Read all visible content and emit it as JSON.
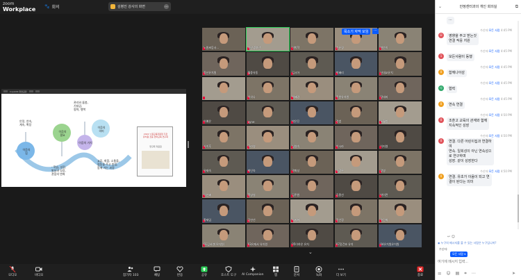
{
  "app": {
    "brand_small": "zoom",
    "brand": "Workplace",
    "meeting_label": "회의",
    "share_label": "김병진 강사의 화면"
  },
  "shared": {
    "doc_title": "CopilotR 화면공유",
    "slide_left_1": "안정, 연속,\n계속, 확장",
    "circle_1": "이음의\n힘",
    "circle_2": "이음의\n필요",
    "circle_3": "이음의 가치",
    "circle_4": "이음의\n의미",
    "caption_top": "관리와 돌봄,\n기대감,\n협력, 행복",
    "caption_mid": "- 학습, 성장,\n발달과 성장,\n관점의 변화",
    "caption_right": "교류, 화합, 소통을,\n협동을 주고 받음,\n함께 가는 과정",
    "thumb_title": "2022 노원교육지원청 기관\n유치원 초등 협력교육 연구회",
    "thumb_sub": "연구회 자료집"
  },
  "gallery": {
    "badge": "목소기 자막 모임",
    "menu": "⋯",
    "tiles": [
      {
        "name": "노원초등사..."
      },
      {
        "name": "이안생영안"
      },
      {
        "name": "이박학"
      },
      {
        "name": "순유경"
      },
      {
        "name": "변순이"
      },
      {
        "name": "중산유치원"
      },
      {
        "name": "월중유동"
      },
      {
        "name": "김시아"
      },
      {
        "name": "박혜리"
      },
      {
        "name": "신대교유치"
      },
      {
        "name": ""
      },
      {
        "name": "이삭나"
      },
      {
        "name": "백혜경"
      },
      {
        "name": "주원유치원"
      },
      {
        "name": "장대지"
      },
      {
        "name": "이예은"
      },
      {
        "name": "ayne"
      },
      {
        "name": "박은진"
      },
      {
        "name": "경범"
      },
      {
        "name": "노월방"
      },
      {
        "name": "사이후"
      },
      {
        "name": "구라영"
      },
      {
        "name": "심영숙"
      },
      {
        "name": "이시라"
      },
      {
        "name": "이지영"
      },
      {
        "name": "유재숙"
      },
      {
        "name": "최인숙"
      },
      {
        "name": "곽화성"
      },
      {
        "name": "사광우"
      },
      {
        "name": "광영"
      },
      {
        "name": "이선혜"
      },
      {
        "name": "홍영실"
      },
      {
        "name": "김주원"
      },
      {
        "name": "김종선"
      },
      {
        "name": "박이란"
      },
      {
        "name": "홍재임"
      },
      {
        "name": "김연선"
      },
      {
        "name": "차지화"
      },
      {
        "name": "정인정"
      },
      {
        "name": "우단화"
      },
      {
        "name": "01김서연(유치원)"
      },
      {
        "name": "03유재서 유치원"
      },
      {
        "name": "05이하은 유치"
      },
      {
        "name": "07장건호 유치"
      },
      {
        "name": "04유치원유치원"
      }
    ]
  },
  "toolbar": {
    "audio": "오디오",
    "video": "비디오",
    "participants": "참가자",
    "participants_count": "103",
    "chat": "채팅",
    "react": "반응",
    "share": "공유",
    "host_tools": "호스트 도구",
    "ai": "AI Companion",
    "apps": "앱",
    "docs": "문서",
    "record": "녹화",
    "more": "더 보기",
    "end": "종료"
  },
  "chat": {
    "title": "안정센터과의 개인 회의실",
    "sender_prefix": "수신자:",
    "all": "모든 사람",
    "messages": [
      {
        "text": "···",
        "time": "",
        "avatar": "",
        "color": "#e1545b"
      },
      {
        "text": "영향을 주고 받는것\n연결 적응 지원",
        "time": "4:45 PM",
        "avatar": "모",
        "color": "#e1545b"
      },
      {
        "text": "모든사람이 동행",
        "time": "4:45 PM",
        "avatar": "1",
        "color": "#e1545b"
      },
      {
        "text": "함께나아감",
        "time": "4:45 PM",
        "avatar": "0",
        "color": "#f0a020"
      },
      {
        "text": "협력",
        "time": "4:45 PM",
        "avatar": "다",
        "color": "#2ea86a"
      },
      {
        "text": "연속 연결",
        "time": "4:45 PM",
        "avatar": "0",
        "color": "#f0a020"
      },
      {
        "text": "조훈고 교육의 관계와 함께\n지속적인 성장",
        "time": "4:50 PM",
        "avatar": "0",
        "color": "#e1545b"
      },
      {
        "text": "연결. 다른 어린이집과 연결하\n여\n연속. 일회성이 아닌 연속성으\n로 연구하며\n성장. 같이 성장한다",
        "time": "4:50 PM",
        "avatar": "0",
        "color": "#e1545b"
      },
      {
        "text": "연결. 유초가 이음이 되고 연\n결이 된다는 의미",
        "time": "4:50 PM",
        "avatar": "0",
        "color": "#f0a020"
      }
    ],
    "notice": "누구의 메시지를 볼 수 있는 사람은 누구입니까?",
    "to_label": "수신자:",
    "to_value": "모든 사람 ▾",
    "input_placeholder": "여기에 메시지 입력..."
  }
}
